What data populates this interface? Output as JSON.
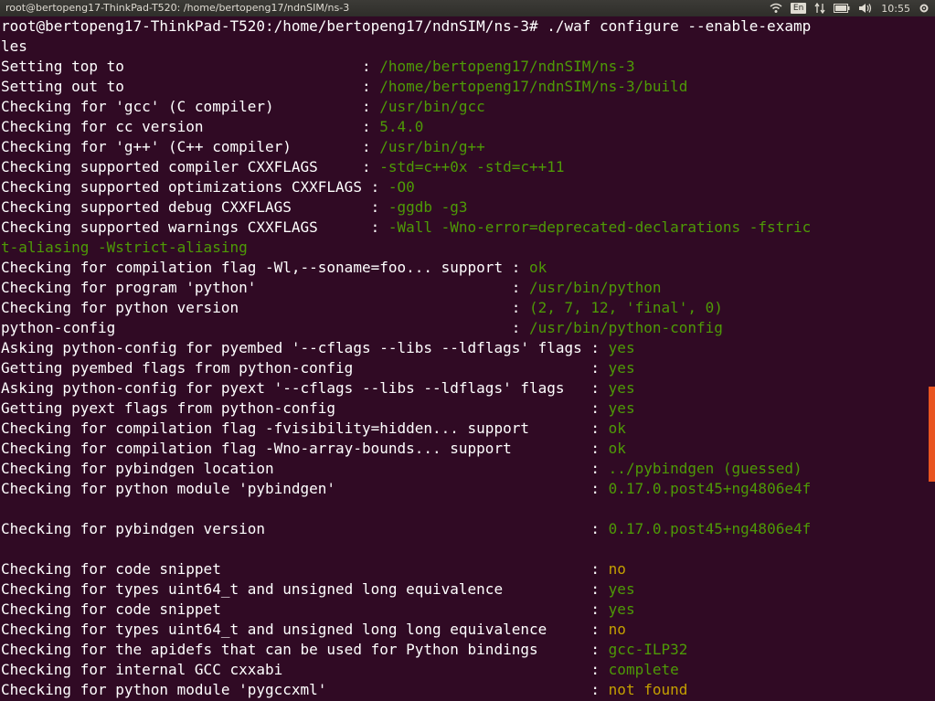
{
  "window": {
    "title": "root@bertopeng17-ThinkPad-T520: /home/bertopeng17/ndnSIM/ns-3"
  },
  "tray": {
    "icons": [
      "wifi-icon",
      "keyboard-lang-icon",
      "transfer-icon",
      "battery-icon",
      "volume-icon"
    ],
    "language": "En",
    "clock": "10:55"
  },
  "colors": {
    "background": "#300a24",
    "text": "#ffffff",
    "green": "#4e9a06",
    "yellow": "#c4a000",
    "scroll_thumb": "#e95420"
  },
  "terminal": {
    "lines": [
      {
        "text": "root@bertopeng17-ThinkPad-T520:/home/bertopeng17/ndnSIM/ns-3# ./waf configure --enable-examp"
      },
      {
        "text": "les"
      },
      {
        "text": "Setting top to                           : ",
        "result": "/home/bertopeng17/ndnSIM/ns-3",
        "color": "green"
      },
      {
        "text": "Setting out to                           : ",
        "result": "/home/bertopeng17/ndnSIM/ns-3/build",
        "color": "green"
      },
      {
        "text": "Checking for 'gcc' (C compiler)          : ",
        "result": "/usr/bin/gcc",
        "color": "green"
      },
      {
        "text": "Checking for cc version                  : ",
        "result": "5.4.0",
        "color": "green"
      },
      {
        "text": "Checking for 'g++' (C++ compiler)        : ",
        "result": "/usr/bin/g++",
        "color": "green"
      },
      {
        "text": "Checking supported compiler CXXFLAGS     : ",
        "result": "-std=c++0x -std=c++11",
        "color": "green"
      },
      {
        "text": "Checking supported optimizations CXXFLAGS : ",
        "result": "-O0",
        "color": "green"
      },
      {
        "text": "Checking supported debug CXXFLAGS         : ",
        "result": "-ggdb -g3",
        "color": "green"
      },
      {
        "text": "Checking supported warnings CXXFLAGS      : ",
        "result": "-Wall -Wno-error=deprecated-declarations -fstric",
        "color": "green"
      },
      {
        "text": "",
        "result": "t-aliasing -Wstrict-aliasing",
        "color": "green"
      },
      {
        "text": "Checking for compilation flag -Wl,--soname=foo... support : ",
        "result": "ok",
        "color": "green"
      },
      {
        "text": "Checking for program 'python'                             : ",
        "result": "/usr/bin/python",
        "color": "green"
      },
      {
        "text": "Checking for python version                               : ",
        "result": "(2, 7, 12, 'final', 0)",
        "color": "green"
      },
      {
        "text": "python-config                                             : ",
        "result": "/usr/bin/python-config",
        "color": "green"
      },
      {
        "text": "Asking python-config for pyembed '--cflags --libs --ldflags' flags : ",
        "result": "yes",
        "color": "green"
      },
      {
        "text": "Getting pyembed flags from python-config                           : ",
        "result": "yes",
        "color": "green"
      },
      {
        "text": "Asking python-config for pyext '--cflags --libs --ldflags' flags   : ",
        "result": "yes",
        "color": "green"
      },
      {
        "text": "Getting pyext flags from python-config                             : ",
        "result": "yes",
        "color": "green"
      },
      {
        "text": "Checking for compilation flag -fvisibility=hidden... support       : ",
        "result": "ok",
        "color": "green"
      },
      {
        "text": "Checking for compilation flag -Wno-array-bounds... support         : ",
        "result": "ok",
        "color": "green"
      },
      {
        "text": "Checking for pybindgen location                                    : ",
        "result": "../pybindgen (guessed)",
        "color": "green"
      },
      {
        "text": "Checking for python module 'pybindgen'                             : ",
        "result": "0.17.0.post45+ng4806e4f",
        "color": "green"
      },
      {
        "text": ""
      },
      {
        "text": "Checking for pybindgen version                                     : ",
        "result": "0.17.0.post45+ng4806e4f",
        "color": "green"
      },
      {
        "text": ""
      },
      {
        "text": "Checking for code snippet                                          : ",
        "result": "no",
        "color": "yellow"
      },
      {
        "text": "Checking for types uint64_t and unsigned long equivalence          : ",
        "result": "yes",
        "color": "green"
      },
      {
        "text": "Checking for code snippet                                          : ",
        "result": "yes",
        "color": "green"
      },
      {
        "text": "Checking for types uint64_t and unsigned long long equivalence     : ",
        "result": "no",
        "color": "yellow"
      },
      {
        "text": "Checking for the apidefs that can be used for Python bindings      : ",
        "result": "gcc-ILP32",
        "color": "green"
      },
      {
        "text": "Checking for internal GCC cxxabi                                   : ",
        "result": "complete",
        "color": "green"
      },
      {
        "text": "Checking for python module 'pygccxml'                              : ",
        "result": "not found",
        "color": "yellow"
      }
    ]
  }
}
